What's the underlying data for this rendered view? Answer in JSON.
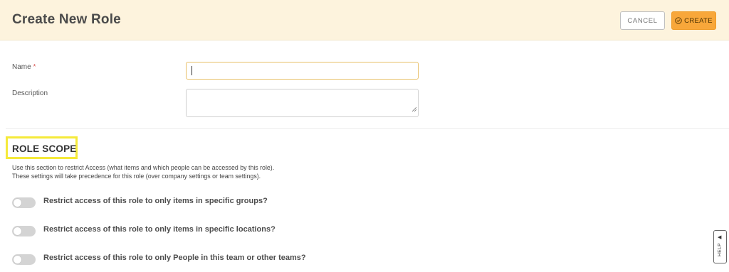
{
  "header": {
    "title": "Create New Role",
    "cancel_label": "CANCEL",
    "create_label": "CREATE",
    "accent_color": "#f8a73a"
  },
  "form": {
    "name_label": "Name",
    "name_required_mark": "*",
    "name_value": "",
    "description_label": "Description",
    "description_value": ""
  },
  "role_scope": {
    "title": "ROLE SCOPE",
    "description_line1": "Use this section to restrict Access (what items and which people can be accessed by this role).",
    "description_line2": "These settings will take precedence for this role (over company settings or team settings).",
    "toggles": [
      {
        "label": "Restrict access of this role to only items in specific groups?",
        "on": false
      },
      {
        "label": "Restrict access of this role to only items in specific locations?",
        "on": false
      },
      {
        "label": "Restrict access of this role to only People in this team or other teams?",
        "on": false
      }
    ]
  },
  "help": {
    "label": "HELP",
    "arrow": "◀"
  },
  "icons": {
    "create_button_icon": "check-circle-icon",
    "help_icon": "triangle-icon",
    "resize_icon": "resize-grip-icon"
  }
}
